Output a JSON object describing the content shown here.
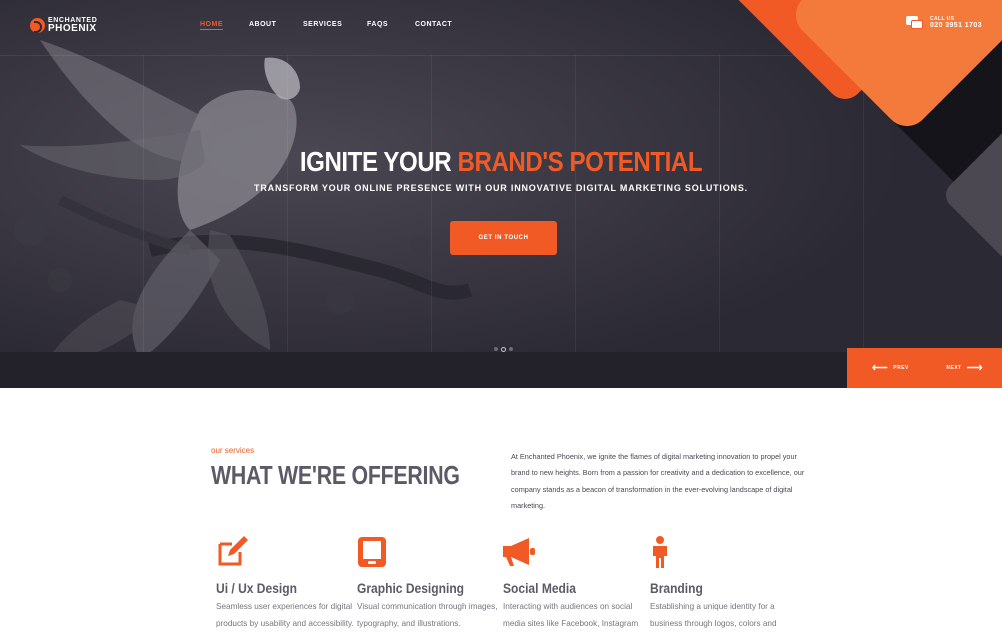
{
  "brand": {
    "logo_top": "ENCHANTED",
    "logo_bottom": "PHOENIX"
  },
  "nav": {
    "items": [
      {
        "label": "HOME",
        "active": true
      },
      {
        "label": "ABOUT",
        "active": false
      },
      {
        "label": "SERVICES",
        "active": false
      },
      {
        "label": "FAQS",
        "active": false
      },
      {
        "label": "CONTACT",
        "active": false
      }
    ]
  },
  "call": {
    "label": "CALL US",
    "number": "020 3951 1703",
    "icon": "chat-bubbles-icon"
  },
  "hero": {
    "title_plain": "IGNITE YOUR ",
    "title_accent": "BRAND'S POTENTIAL",
    "subtitle": "TRANSFORM YOUR ONLINE PRESENCE WITH OUR INNOVATIVE DIGITAL MARKETING SOLUTIONS.",
    "cta": "GET IN TOUCH",
    "slide_count": 3,
    "active_slide": 2,
    "prev": "PREV",
    "next": "NEXT"
  },
  "services": {
    "eyebrow": "our services",
    "title": "WHAT WE'RE OFFERING",
    "intro": "At Enchanted Phoenix, we ignite the flames of digital marketing innovation to propel your brand to new heights. Born from a passion for creativity and a dedication to excellence, our company stands as a beacon of transformation in the ever-evolving landscape of digital marketing.",
    "cards": [
      {
        "title": "Ui / Ux Design",
        "desc": "Seamless user experiences for digital products by usability and accessibility.",
        "icon": "edit-icon"
      },
      {
        "title": "Graphic Designing",
        "desc": "Visual communication through images, typography, and illustrations.",
        "icon": "tablet-icon"
      },
      {
        "title": "Social Media",
        "desc": "Interacting with audiences on social media sites like Facebook, Instagram and Twitter.",
        "icon": "megaphone-icon"
      },
      {
        "title": "Branding",
        "desc": "Establishing a unique identity for a business through logos, colors and messaging.",
        "icon": "person-icon"
      }
    ]
  },
  "colors": {
    "accent": "#f15a24",
    "hero_bg": "#2b2933",
    "heading": "#5c5a67"
  }
}
